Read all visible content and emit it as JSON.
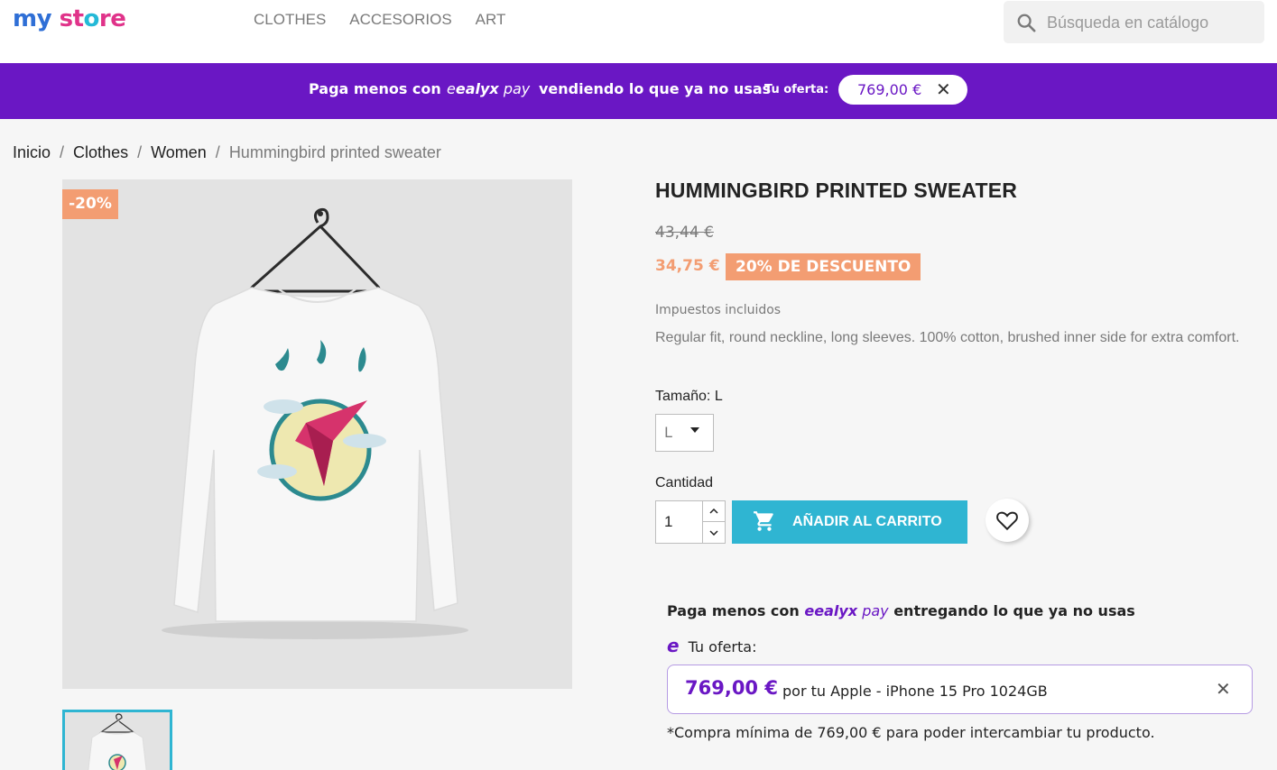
{
  "header": {
    "logo": {
      "part1": "my ",
      "part2": "st",
      "part3": "o",
      "part4": "re"
    },
    "nav": [
      {
        "label": "CLOTHES"
      },
      {
        "label": "ACCESORIOS"
      },
      {
        "label": "ART"
      }
    ],
    "search": {
      "placeholder": "Búsqueda en catálogo"
    }
  },
  "banner": {
    "text1": "Paga menos con",
    "brand_e": "e",
    "brand_name": "ealyx",
    "brand_pay": " pay",
    "text2": "vendiendo lo que ya no usas",
    "offer_label": "Tu oferta:",
    "offer_value": "769,00 €",
    "close": "✕",
    "color": "#6a17c4"
  },
  "breadcrumb": [
    {
      "label": "Inicio"
    },
    {
      "label": "Clothes"
    },
    {
      "label": "Women"
    },
    {
      "label": "Hummingbird printed sweater"
    }
  ],
  "breadcrumb_sep": "/",
  "product": {
    "badge": "-20%",
    "title": "HUMMINGBIRD PRINTED SWEATER",
    "regular_price": "43,44 €",
    "price": "34,75 €",
    "discount_label": "20% DE DESCUENTO",
    "taxes": "Impuestos incluidos",
    "description": "Regular fit, round neckline, long sleeves. 100% cotton, brushed inner side for extra comfort.",
    "size_label": "Tamaño: L",
    "size_selected": "L",
    "qty_label": "Cantidad",
    "qty_value": "1",
    "add_to_cart": "AÑADIR AL CARRITO",
    "accent_color": "#2fb5d2",
    "discount_color": "#f39d72"
  },
  "ealyx_widget": {
    "head_text1": "Paga menos con ",
    "head_brand_e": "e",
    "head_brand": "ealyx",
    "head_pay": " pay",
    "head_text2": " entregando lo que ya no usas",
    "offer_label": "Tu oferta:",
    "offer_amount": "769,00 €",
    "offer_device": "por tu Apple - iPhone 15 Pro 1024GB",
    "close": "✕",
    "note": "*Compra mínima de 769,00 € para poder intercambiar tu producto."
  }
}
